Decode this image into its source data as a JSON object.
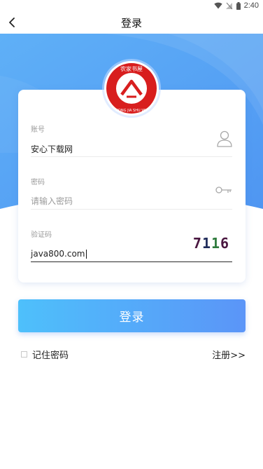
{
  "status_bar": {
    "time": "2:40"
  },
  "header": {
    "title": "登录",
    "back_icon": "chevron-left-icon"
  },
  "theme": {
    "accent_start": "#4ec0fb",
    "accent_end": "#5b95f8",
    "hero": "#5aa6f6",
    "logo_red": "#d81e1e"
  },
  "logo": {
    "top_text": "农家书屋",
    "bottom_text": "NONG JIA SHU WU"
  },
  "form": {
    "account": {
      "label": "账号",
      "value": "安心下载网",
      "icon": "user-icon"
    },
    "password": {
      "label": "密码",
      "placeholder": "请输入密码",
      "icon": "key-icon"
    },
    "captcha": {
      "label": "验证码",
      "value": "java800.com",
      "image_text": [
        "7",
        "1",
        "1",
        "6"
      ],
      "image_colors": [
        "#4a1740",
        "#1f2b5a",
        "#2e7a3c",
        "#4a1740"
      ]
    }
  },
  "login_button": {
    "label": "登录"
  },
  "remember": {
    "label": "记住密码",
    "checked": false
  },
  "register": {
    "label": "注册>>"
  }
}
